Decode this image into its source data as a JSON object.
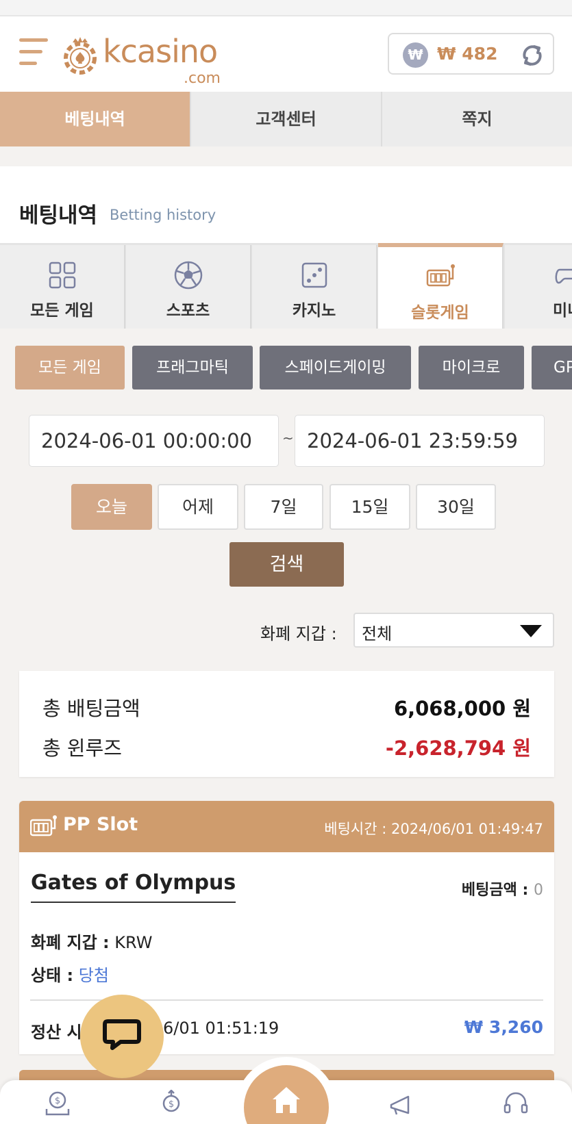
{
  "header": {
    "logo_text": "kcasino",
    "logo_sub": ".com",
    "wallet_symbol": "₩",
    "wallet_amount": "₩ 482"
  },
  "main_tabs": [
    {
      "label": "베팅내역",
      "active": true
    },
    {
      "label": "고객센터",
      "active": false
    },
    {
      "label": "쪽지",
      "active": false
    }
  ],
  "section": {
    "title": "베팅내역",
    "subtitle": "Betting history"
  },
  "categories": [
    {
      "label": "모든 게임",
      "icon": "grid-icon"
    },
    {
      "label": "스포츠",
      "icon": "soccer-ball-icon"
    },
    {
      "label": "카지노",
      "icon": "dice-icon"
    },
    {
      "label": "슬롯게임",
      "icon": "slot-machine-icon",
      "active": true
    },
    {
      "label": "미니",
      "icon": "gamepad-icon"
    }
  ],
  "providers": [
    {
      "label": "모든 게임",
      "active": true
    },
    {
      "label": "프래그마틱"
    },
    {
      "label": "스페이드게이밍"
    },
    {
      "label": "마이크로"
    },
    {
      "label": "GP"
    }
  ],
  "date_range": {
    "from": "2024-06-01 00:00:00",
    "separator": "~",
    "to": "2024-06-01 23:59:59"
  },
  "quick_ranges": [
    "오늘",
    "어제",
    "7일",
    "15일",
    "30일"
  ],
  "search_label": "검색",
  "wallet_filter": {
    "label": "화폐 지갑 :",
    "value": "전체"
  },
  "summary": {
    "total_bet_label": "총 배팅금액",
    "total_bet_value": "6,068,000 원",
    "total_winloss_label": "총 윈루즈",
    "total_winloss_value": "-2,628,794 원"
  },
  "bet_card": {
    "provider": "PP Slot",
    "bet_time": "베팅시간 : 2024/06/01 01:49:47",
    "game_name": "Gates of Olympus",
    "bet_amount_label": "베팅금액 :",
    "bet_amount_value": "0",
    "currency_label": "화폐 지갑 :",
    "currency_value": "KRW",
    "status_label": "상태 :",
    "status_value": "당첨",
    "settle_label": "정산 시",
    "settle_time": "6/01 01:51:19",
    "settle_amount": "₩ 3,260"
  },
  "colors": {
    "accent": "#dcb291",
    "accent_dark": "#8b6b52",
    "card_header": "#cf9c6d",
    "negative": "#c8232c",
    "win": "#4d78d6",
    "provider_bg": "#6f707a"
  },
  "bottom_nav": [
    "deposit-icon",
    "withdraw-icon",
    "home-icon",
    "promotion-icon",
    "support-headset-icon"
  ]
}
